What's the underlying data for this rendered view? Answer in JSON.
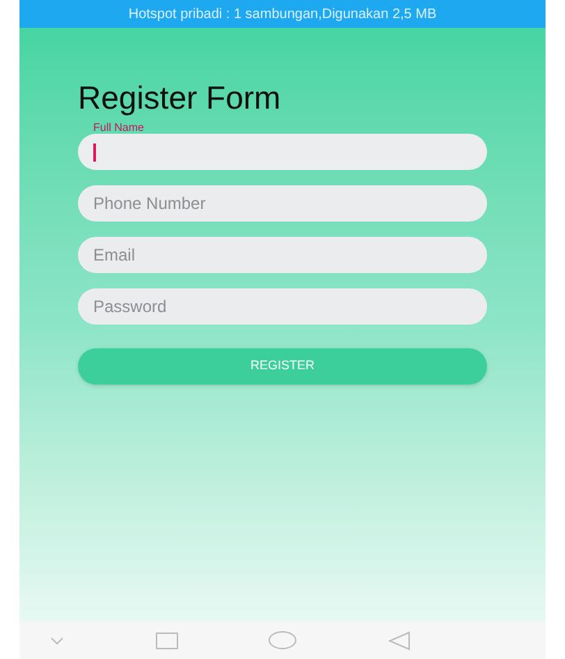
{
  "status_bar": {
    "text": "Hotspot pribadi : 1 sambungan,Digunakan 2,5 MB"
  },
  "title": "Register Form",
  "fields": [
    {
      "label": "Full Name",
      "focused": true
    },
    {
      "placeholder": "Phone Number",
      "focused": false
    },
    {
      "placeholder": "Email",
      "focused": false
    },
    {
      "placeholder": "Password",
      "focused": false
    }
  ],
  "button": "REGISTER"
}
